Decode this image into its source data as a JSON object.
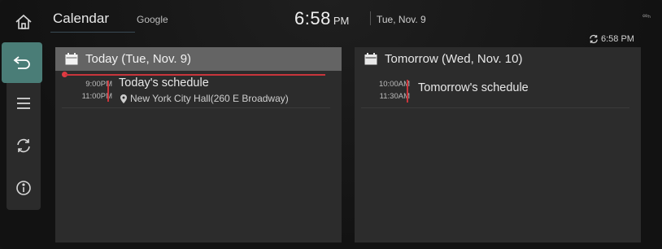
{
  "header": {
    "app_title": "Calendar",
    "account": "Google",
    "clock": "6:58",
    "clock_ampm": "PM",
    "date": "Tue, Nov. 9",
    "signal": "∞ₕ",
    "sync_time": "6:58 PM"
  },
  "rail": {
    "items": [
      {
        "icon": "home-icon"
      },
      {
        "icon": "back-icon"
      },
      {
        "icon": "menu-icon"
      },
      {
        "icon": "sync-icon"
      },
      {
        "icon": "info-icon"
      }
    ]
  },
  "today": {
    "heading": "Today (Tue, Nov. 9)",
    "events": [
      {
        "start": "9:00PM",
        "end": "11:00PM",
        "title": "Today's schedule",
        "location": "New York City Hall(260 E Broadway)"
      }
    ]
  },
  "tomorrow": {
    "heading": "Tomorrow (Wed, Nov. 10)",
    "events": [
      {
        "start": "10:00AM",
        "end": "11:30AM",
        "title": "Tomorrow's schedule"
      }
    ]
  },
  "colors": {
    "accent_teal": "#4a7d77",
    "event_red": "#c9353b",
    "panel_bg": "#2c2c2c",
    "today_header": "#646464"
  }
}
